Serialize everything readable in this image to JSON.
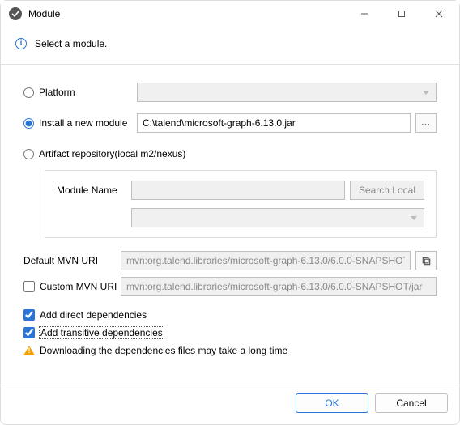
{
  "window": {
    "title": "Module"
  },
  "banner": {
    "message": "Select a module."
  },
  "options": {
    "platform": {
      "label": "Platform",
      "selected": false
    },
    "install": {
      "label": "Install a new module",
      "selected": true,
      "path": "C:\\talend\\microsoft-graph-6.13.0.jar"
    },
    "repository": {
      "label": "Artifact repository(local m2/nexus)",
      "selected": false
    }
  },
  "repoGroup": {
    "module_name_label": "Module Name",
    "search_local_label": "Search Local"
  },
  "defaultMvn": {
    "label": "Default MVN URI",
    "value": "mvn:org.talend.libraries/microsoft-graph-6.13.0/6.0.0-SNAPSHOT"
  },
  "customMvn": {
    "label": "Custom MVN URI",
    "checked": false,
    "value": "mvn:org.talend.libraries/microsoft-graph-6.13.0/6.0.0-SNAPSHOT/jar"
  },
  "directDeps": {
    "label": "Add direct dependencies",
    "checked": true
  },
  "transitiveDeps": {
    "label": "Add transitive dependencies",
    "checked": true
  },
  "warning": "Downloading the dependencies files may take a long time",
  "buttons": {
    "ok": "OK",
    "cancel": "Cancel"
  }
}
